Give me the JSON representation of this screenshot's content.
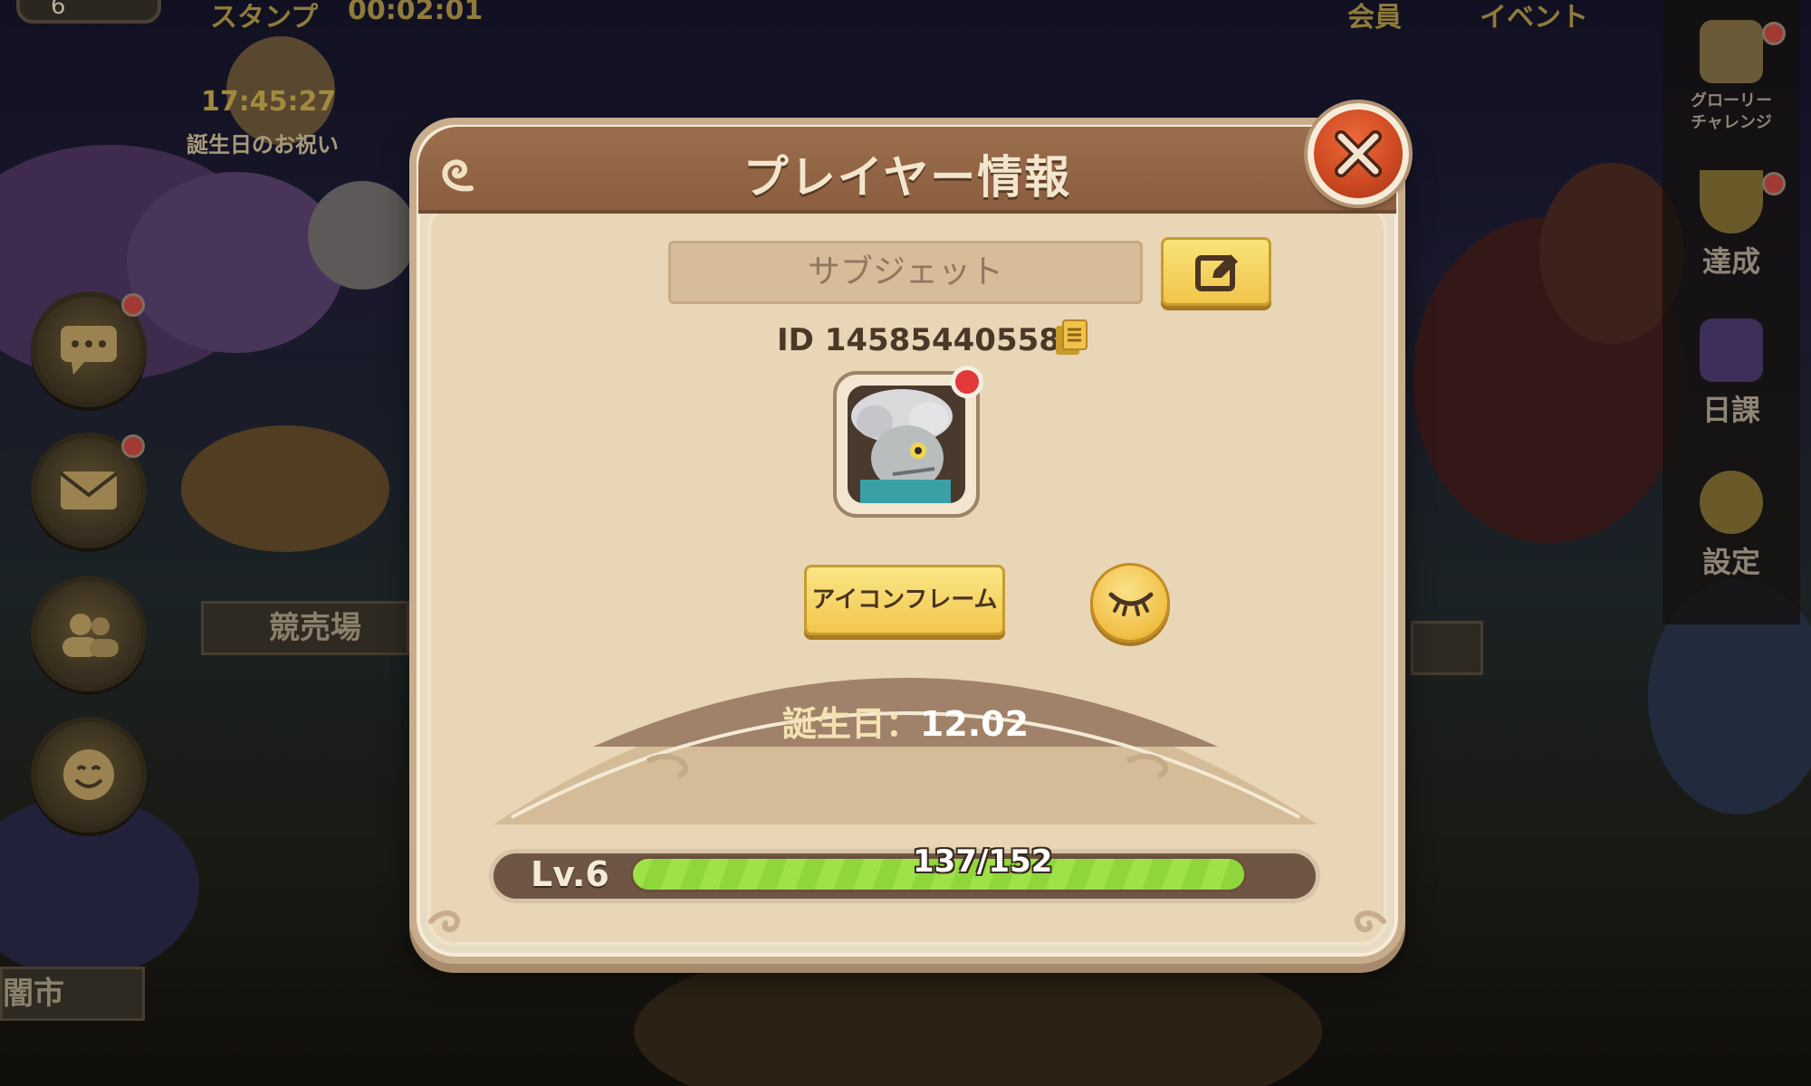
{
  "background": {
    "top_left_number": "6",
    "top_left_label": "スタンプ",
    "top_timer": "00:02:01",
    "top_right_labels": [
      "会員",
      "イベント"
    ],
    "event_timer": "17:45:27",
    "event_label": "誕生日のお祝い",
    "left_buttons": [
      {
        "icon": "chat-icon",
        "has_badge": true
      },
      {
        "icon": "mail-icon",
        "has_badge": true
      },
      {
        "icon": "friends-icon",
        "has_badge": false
      },
      {
        "icon": "emoji-icon",
        "has_badge": false
      }
    ],
    "signs": {
      "auction": "競売場",
      "black_market": "闇市"
    },
    "right_menu": [
      {
        "label": "グローリー\nチャレンジ",
        "icon": "glory-challenge-icon",
        "has_badge": true
      },
      {
        "label": "達成",
        "icon": "trophy-icon",
        "has_badge": true
      },
      {
        "label": "日課",
        "icon": "daily-book-icon",
        "has_badge": false
      },
      {
        "label": "設定",
        "icon": "gear-icon",
        "has_badge": false
      }
    ]
  },
  "dialog": {
    "title": "プレイヤー情報",
    "name_field": "サブジェット",
    "id_text": "ID 145854405587",
    "avatar_has_badge": true,
    "icon_frame_button": "アイコンフレーム",
    "birthday_label": "誕生日：",
    "birthday_value": "12.02",
    "level_label": "Lv.6",
    "xp_current": 137,
    "xp_max": 152,
    "xp_text": "137/152"
  },
  "colors": {
    "title_bar": "#8a5e3f",
    "dialog_bg": "#e8d6b6",
    "button_yellow": "#f2c64e",
    "close_red": "#cf4a22",
    "xp_green": "#9ee247",
    "badge_red": "#e2393b"
  }
}
